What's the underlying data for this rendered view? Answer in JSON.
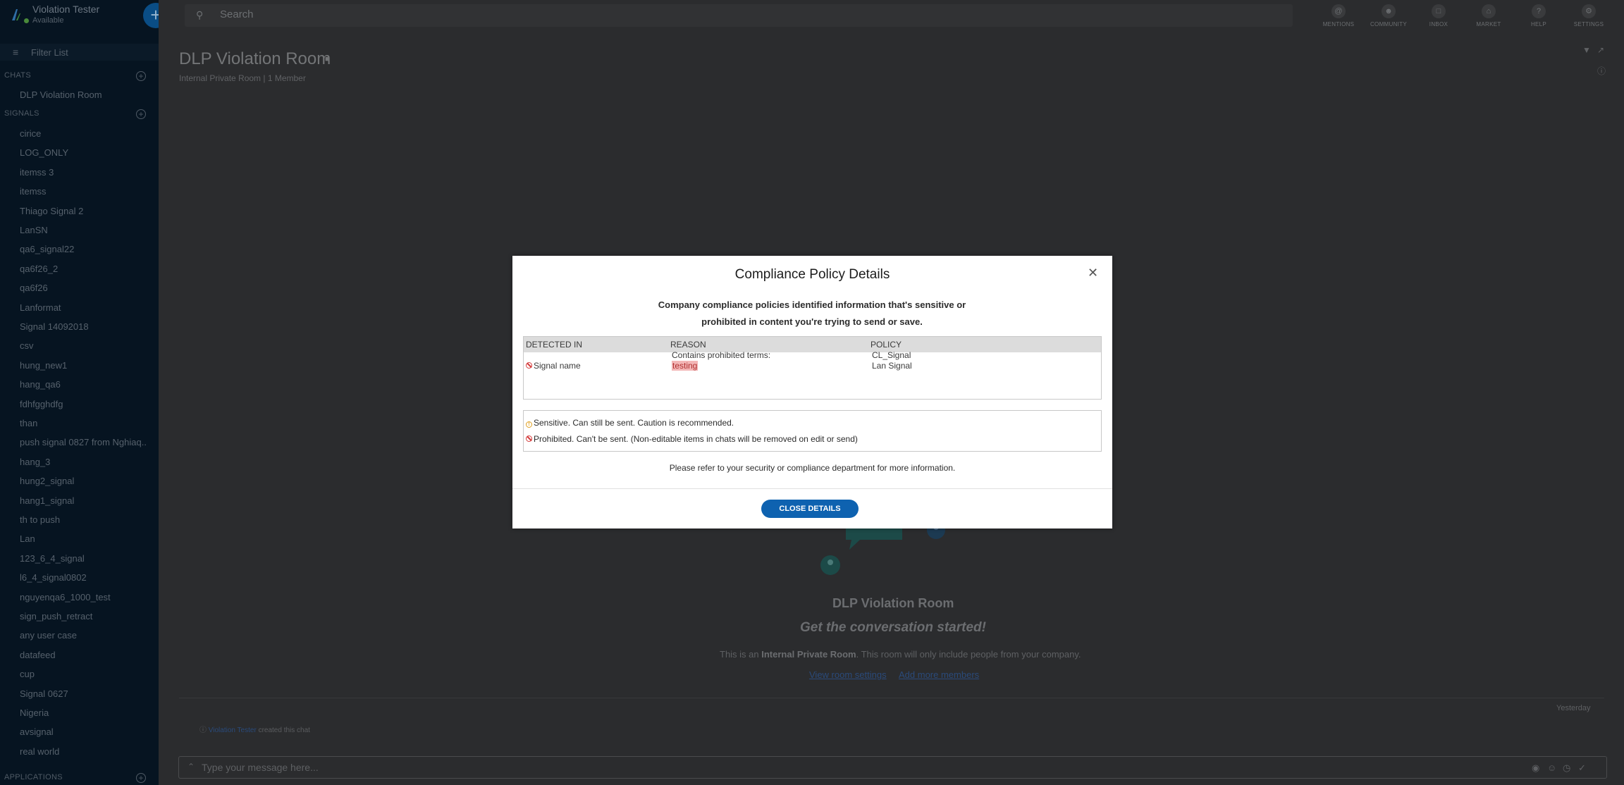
{
  "user": {
    "name": "Violation Tester",
    "status": "Available"
  },
  "filter": {
    "label": "Filter List"
  },
  "sidebar": {
    "chats_header": "CHATS",
    "chats": [
      "DLP Violation Room"
    ],
    "signals_header": "SIGNALS",
    "signals": [
      "cirice",
      "LOG_ONLY",
      "itemss 3",
      "itemss",
      "Thiago Signal 2",
      "LanSN",
      "qa6_signal22",
      "qa6f26_2",
      "qa6f26",
      "Lanformat",
      "Signal 14092018",
      "csv",
      "hung_new1",
      "hang_qa6",
      "fdhfgghdfg",
      "than",
      "push signal 0827 from Nghiaq...",
      "hang_3",
      "hung2_signal",
      "hang1_signal",
      "th to push",
      "Lan",
      "123_6_4_signal",
      "l6_4_signal0802",
      "nguyenqa6_1000_test",
      "sign_push_retract",
      "any user case",
      "datafeed",
      "cup",
      "Signal 0627",
      "Nigeria",
      "avsignal",
      "real world"
    ],
    "applications_header": "APPLICATIONS"
  },
  "topbar": {
    "search_placeholder": "Search",
    "nav": [
      "MENTIONS",
      "COMMUNITY",
      "INBOX",
      "MARKET",
      "HELP",
      "SETTINGS"
    ]
  },
  "room": {
    "title": "DLP Violation Room",
    "subtitle": "Internal Private Room | 1 Member"
  },
  "empty_state": {
    "title": "DLP Violation Room",
    "subtitle": "Get the conversation started!",
    "desc_pre": "This is an ",
    "desc_bold": "Internal Private Room",
    "desc_post": ". This room will only include people from your company.",
    "link_settings": "View room settings",
    "link_members": "Add more members"
  },
  "timeline": {
    "yesterday": "Yesterday",
    "creator": "Violation Tester",
    "created_text": "created this chat"
  },
  "composer": {
    "placeholder": "Type your message here..."
  },
  "modal": {
    "title": "Compliance Policy Details",
    "description_line1": "Company compliance policies identified information that's sensitive or",
    "description_line2": "prohibited in content you're trying to send or save.",
    "columns": [
      "DETECTED IN",
      "REASON",
      "POLICY"
    ],
    "row": {
      "detected_in": "Signal name",
      "reason": "Contains prohibited terms:",
      "term": "testing",
      "policies": [
        "CL_Signal",
        "Lan Signal"
      ]
    },
    "legend_sensitive": "Sensitive. Can still be sent. Caution is recommended.",
    "legend_prohibited": "Prohibited. Can't be sent. (Non-editable items in chats will be removed on edit or send)",
    "note": "Please refer to your security or compliance department for more information.",
    "close_button": "CLOSE DETAILS"
  },
  "colors": {
    "accent": "#0e62b0",
    "sidebar": "#061421",
    "prohibited": "#d43b3b",
    "sensitive": "#e0a020"
  }
}
